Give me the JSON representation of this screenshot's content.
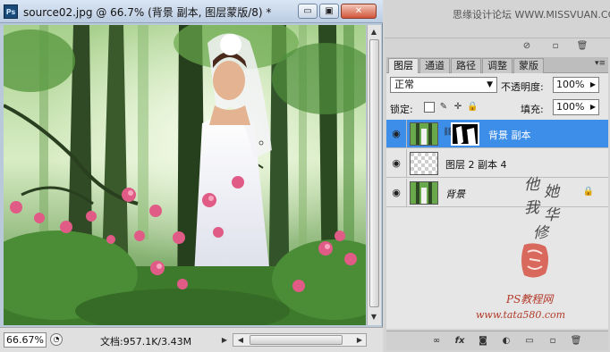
{
  "app": {
    "icon_label": "Ps",
    "document_title": "source02.jpg @ 66.7% (背景 副本, 图层蒙版/8) *",
    "window_buttons": {
      "minimize": "▭",
      "maximize": "▣",
      "close": "✕"
    }
  },
  "status": {
    "zoom": "66.67%",
    "doc_size": "文档:957.1K/3.43M"
  },
  "panel": {
    "watermark_top": "思缘设计论坛 WWW.MISSVUAN.COM",
    "tabs": [
      {
        "label": "图层",
        "active": true
      },
      {
        "label": "通道",
        "active": false
      },
      {
        "label": "路径",
        "active": false
      },
      {
        "label": "调整",
        "active": false
      },
      {
        "label": "蒙版",
        "active": false
      }
    ],
    "blend_mode": "正常",
    "opacity_label": "不透明度:",
    "opacity_value": "100%",
    "lock_label": "锁定:",
    "fill_label": "填充:",
    "fill_value": "100%",
    "layers": [
      {
        "name": "背景 副本",
        "selected": true,
        "has_mask": true,
        "locked": false,
        "thumb": "forest"
      },
      {
        "name": "图层 2 副本 4",
        "selected": false,
        "has_mask": false,
        "locked": false,
        "thumb": "transparent"
      },
      {
        "name": "背景",
        "selected": false,
        "has_mask": false,
        "locked": true,
        "thumb": "forest"
      }
    ],
    "watermark_vertical": [
      "他",
      "她",
      "我",
      "华",
      "修"
    ],
    "watermark_site_cn": "PS教程网",
    "watermark_site": "www.tata580.com"
  },
  "colors": {
    "selection": "#3d8ee8",
    "title_bar": "#c9d8ea",
    "close_button": "#d1553a"
  },
  "icons": {
    "visibility": "eye-icon",
    "link": "chain-link-icon",
    "lock": "padlock-icon"
  }
}
